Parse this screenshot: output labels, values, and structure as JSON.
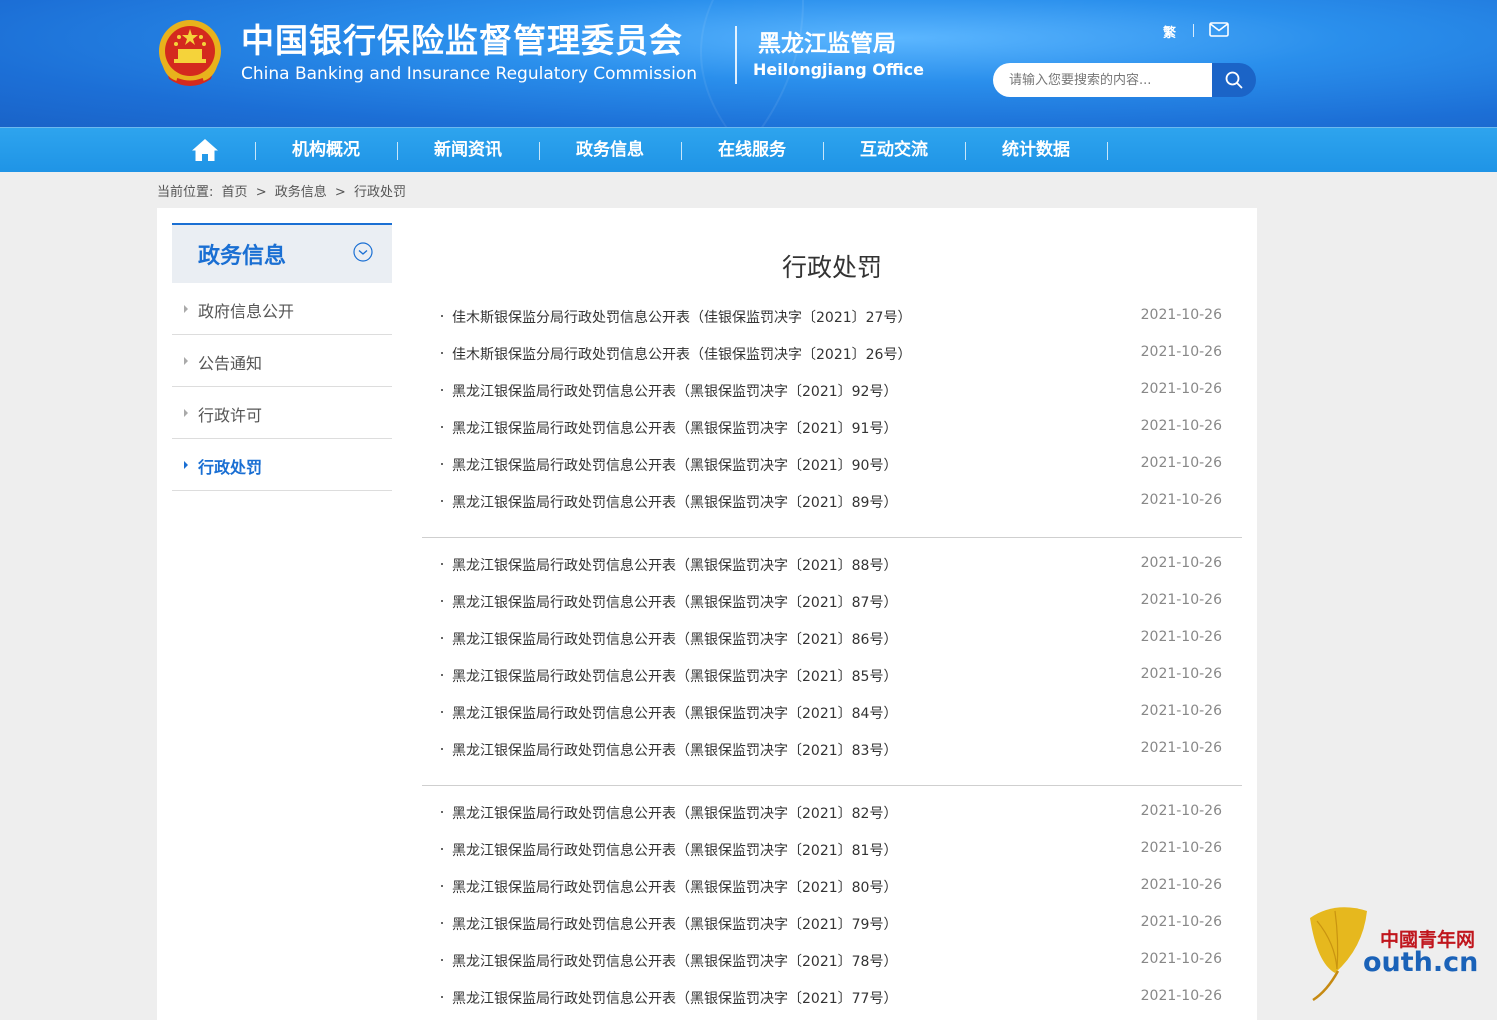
{
  "header": {
    "title_cn": "中国银行保险监督管理委员会",
    "title_en": "China Banking and Insurance Regulatory Commission",
    "office_cn": "黑龙江监管局",
    "office_en": "Heilongjiang Office",
    "lang_link": "繁",
    "search_placeholder": "请输入您要搜索的内容...",
    "icons": [
      "national-emblem-icon",
      "mail-icon",
      "search-icon"
    ],
    "accent_color": "#1a6fd3"
  },
  "nav": {
    "home_icon": "home-icon",
    "items": [
      "机构概况",
      "新闻资讯",
      "政务信息",
      "在线服务",
      "互动交流",
      "统计数据"
    ]
  },
  "breadcrumb": {
    "label": "当前位置:",
    "items": [
      "首页",
      "政务信息",
      "行政处罚"
    ],
    "separator": ">"
  },
  "sidebar": {
    "title": "政务信息",
    "items": [
      {
        "label": "政府信息公开"
      },
      {
        "label": "公告通知"
      },
      {
        "label": "行政许可"
      },
      {
        "label": "行政处罚"
      }
    ]
  },
  "content": {
    "title": "行政处罚",
    "groups": [
      [
        {
          "title": "佳木斯银保监分局行政处罚信息公开表（佳银保监罚决字〔2021〕27号）",
          "date": "2021-10-26"
        },
        {
          "title": "佳木斯银保监分局行政处罚信息公开表（佳银保监罚决字〔2021〕26号）",
          "date": "2021-10-26"
        },
        {
          "title": "黑龙江银保监局行政处罚信息公开表（黑银保监罚决字〔2021〕92号）",
          "date": "2021-10-26"
        },
        {
          "title": "黑龙江银保监局行政处罚信息公开表（黑银保监罚决字〔2021〕91号）",
          "date": "2021-10-26"
        },
        {
          "title": "黑龙江银保监局行政处罚信息公开表（黑银保监罚决字〔2021〕90号）",
          "date": "2021-10-26"
        },
        {
          "title": "黑龙江银保监局行政处罚信息公开表（黑银保监罚决字〔2021〕89号）",
          "date": "2021-10-26"
        }
      ],
      [
        {
          "title": "黑龙江银保监局行政处罚信息公开表（黑银保监罚决字〔2021〕88号）",
          "date": "2021-10-26"
        },
        {
          "title": "黑龙江银保监局行政处罚信息公开表（黑银保监罚决字〔2021〕87号）",
          "date": "2021-10-26"
        },
        {
          "title": "黑龙江银保监局行政处罚信息公开表（黑银保监罚决字〔2021〕86号）",
          "date": "2021-10-26"
        },
        {
          "title": "黑龙江银保监局行政处罚信息公开表（黑银保监罚决字〔2021〕85号）",
          "date": "2021-10-26"
        },
        {
          "title": "黑龙江银保监局行政处罚信息公开表（黑银保监罚决字〔2021〕84号）",
          "date": "2021-10-26"
        },
        {
          "title": "黑龙江银保监局行政处罚信息公开表（黑银保监罚决字〔2021〕83号）",
          "date": "2021-10-26"
        }
      ],
      [
        {
          "title": "黑龙江银保监局行政处罚信息公开表（黑银保监罚决字〔2021〕82号）",
          "date": "2021-10-26"
        },
        {
          "title": "黑龙江银保监局行政处罚信息公开表（黑银保监罚决字〔2021〕81号）",
          "date": "2021-10-26"
        },
        {
          "title": "黑龙江银保监局行政处罚信息公开表（黑银保监罚决字〔2021〕80号）",
          "date": "2021-10-26"
        },
        {
          "title": "黑龙江银保监局行政处罚信息公开表（黑银保监罚决字〔2021〕79号）",
          "date": "2021-10-26"
        },
        {
          "title": "黑龙江银保监局行政处罚信息公开表（黑银保监罚决字〔2021〕78号）",
          "date": "2021-10-26"
        },
        {
          "title": "黑龙江银保监局行政处罚信息公开表（黑银保监罚决字〔2021〕77号）",
          "date": "2021-10-26"
        }
      ]
    ]
  },
  "watermark": {
    "cn": "中國青年网",
    "en": "outh.cn"
  }
}
